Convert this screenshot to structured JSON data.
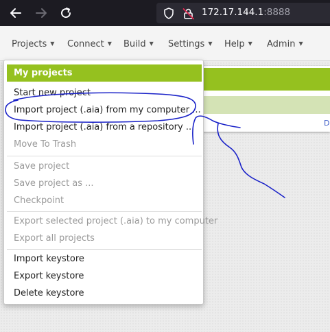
{
  "browser": {
    "url_host": "172.17.144.1",
    "url_port": ":8888"
  },
  "menubar": {
    "items": [
      {
        "label": "Projects"
      },
      {
        "label": "Connect"
      },
      {
        "label": "Build"
      },
      {
        "label": "Settings"
      },
      {
        "label": "Help"
      },
      {
        "label": "Admin"
      }
    ]
  },
  "dropdown": {
    "header": "My projects",
    "items": [
      {
        "label": "Start new project",
        "enabled": true
      },
      {
        "label": "Import project (.aia) from my computer ...",
        "enabled": true
      },
      {
        "label": "Import project (.aia) from a repository ...",
        "enabled": true
      },
      {
        "label": "Move To Trash",
        "enabled": false
      },
      {
        "label": "Save project",
        "enabled": false
      },
      {
        "label": "Save project as ...",
        "enabled": false
      },
      {
        "label": "Checkpoint",
        "enabled": false
      },
      {
        "label": "Export selected project (.aia) to my computer",
        "enabled": false
      },
      {
        "label": "Export all projects",
        "enabled": false
      },
      {
        "label": "Import keystore",
        "enabled": true
      },
      {
        "label": "Export keystore",
        "enabled": true
      },
      {
        "label": "Delete keystore",
        "enabled": true
      }
    ]
  },
  "panel": {
    "link_text": "D"
  },
  "colors": {
    "accent_green": "#95c11f",
    "annotation_blue": "#1a22c8"
  }
}
